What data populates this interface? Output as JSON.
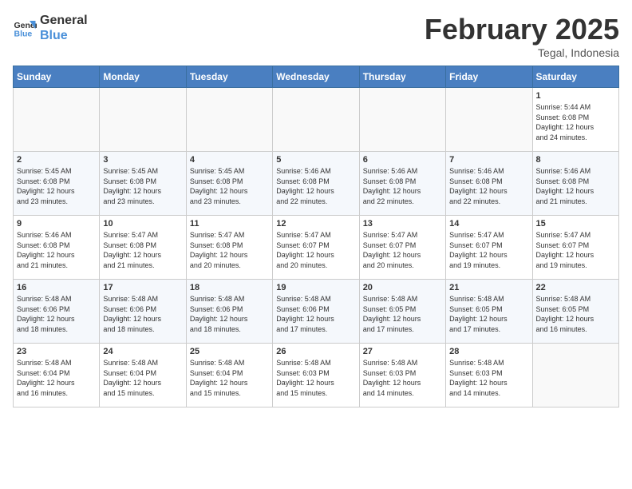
{
  "header": {
    "logo_text1": "General",
    "logo_text2": "Blue",
    "month": "February 2025",
    "location": "Tegal, Indonesia"
  },
  "days_of_week": [
    "Sunday",
    "Monday",
    "Tuesday",
    "Wednesday",
    "Thursday",
    "Friday",
    "Saturday"
  ],
  "weeks": [
    [
      {
        "day": "",
        "info": ""
      },
      {
        "day": "",
        "info": ""
      },
      {
        "day": "",
        "info": ""
      },
      {
        "day": "",
        "info": ""
      },
      {
        "day": "",
        "info": ""
      },
      {
        "day": "",
        "info": ""
      },
      {
        "day": "1",
        "info": "Sunrise: 5:44 AM\nSunset: 6:08 PM\nDaylight: 12 hours\nand 24 minutes."
      }
    ],
    [
      {
        "day": "2",
        "info": "Sunrise: 5:45 AM\nSunset: 6:08 PM\nDaylight: 12 hours\nand 23 minutes."
      },
      {
        "day": "3",
        "info": "Sunrise: 5:45 AM\nSunset: 6:08 PM\nDaylight: 12 hours\nand 23 minutes."
      },
      {
        "day": "4",
        "info": "Sunrise: 5:45 AM\nSunset: 6:08 PM\nDaylight: 12 hours\nand 23 minutes."
      },
      {
        "day": "5",
        "info": "Sunrise: 5:46 AM\nSunset: 6:08 PM\nDaylight: 12 hours\nand 22 minutes."
      },
      {
        "day": "6",
        "info": "Sunrise: 5:46 AM\nSunset: 6:08 PM\nDaylight: 12 hours\nand 22 minutes."
      },
      {
        "day": "7",
        "info": "Sunrise: 5:46 AM\nSunset: 6:08 PM\nDaylight: 12 hours\nand 22 minutes."
      },
      {
        "day": "8",
        "info": "Sunrise: 5:46 AM\nSunset: 6:08 PM\nDaylight: 12 hours\nand 21 minutes."
      }
    ],
    [
      {
        "day": "9",
        "info": "Sunrise: 5:46 AM\nSunset: 6:08 PM\nDaylight: 12 hours\nand 21 minutes."
      },
      {
        "day": "10",
        "info": "Sunrise: 5:47 AM\nSunset: 6:08 PM\nDaylight: 12 hours\nand 21 minutes."
      },
      {
        "day": "11",
        "info": "Sunrise: 5:47 AM\nSunset: 6:08 PM\nDaylight: 12 hours\nand 20 minutes."
      },
      {
        "day": "12",
        "info": "Sunrise: 5:47 AM\nSunset: 6:07 PM\nDaylight: 12 hours\nand 20 minutes."
      },
      {
        "day": "13",
        "info": "Sunrise: 5:47 AM\nSunset: 6:07 PM\nDaylight: 12 hours\nand 20 minutes."
      },
      {
        "day": "14",
        "info": "Sunrise: 5:47 AM\nSunset: 6:07 PM\nDaylight: 12 hours\nand 19 minutes."
      },
      {
        "day": "15",
        "info": "Sunrise: 5:47 AM\nSunset: 6:07 PM\nDaylight: 12 hours\nand 19 minutes."
      }
    ],
    [
      {
        "day": "16",
        "info": "Sunrise: 5:48 AM\nSunset: 6:06 PM\nDaylight: 12 hours\nand 18 minutes."
      },
      {
        "day": "17",
        "info": "Sunrise: 5:48 AM\nSunset: 6:06 PM\nDaylight: 12 hours\nand 18 minutes."
      },
      {
        "day": "18",
        "info": "Sunrise: 5:48 AM\nSunset: 6:06 PM\nDaylight: 12 hours\nand 18 minutes."
      },
      {
        "day": "19",
        "info": "Sunrise: 5:48 AM\nSunset: 6:06 PM\nDaylight: 12 hours\nand 17 minutes."
      },
      {
        "day": "20",
        "info": "Sunrise: 5:48 AM\nSunset: 6:05 PM\nDaylight: 12 hours\nand 17 minutes."
      },
      {
        "day": "21",
        "info": "Sunrise: 5:48 AM\nSunset: 6:05 PM\nDaylight: 12 hours\nand 17 minutes."
      },
      {
        "day": "22",
        "info": "Sunrise: 5:48 AM\nSunset: 6:05 PM\nDaylight: 12 hours\nand 16 minutes."
      }
    ],
    [
      {
        "day": "23",
        "info": "Sunrise: 5:48 AM\nSunset: 6:04 PM\nDaylight: 12 hours\nand 16 minutes."
      },
      {
        "day": "24",
        "info": "Sunrise: 5:48 AM\nSunset: 6:04 PM\nDaylight: 12 hours\nand 15 minutes."
      },
      {
        "day": "25",
        "info": "Sunrise: 5:48 AM\nSunset: 6:04 PM\nDaylight: 12 hours\nand 15 minutes."
      },
      {
        "day": "26",
        "info": "Sunrise: 5:48 AM\nSunset: 6:03 PM\nDaylight: 12 hours\nand 15 minutes."
      },
      {
        "day": "27",
        "info": "Sunrise: 5:48 AM\nSunset: 6:03 PM\nDaylight: 12 hours\nand 14 minutes."
      },
      {
        "day": "28",
        "info": "Sunrise: 5:48 AM\nSunset: 6:03 PM\nDaylight: 12 hours\nand 14 minutes."
      },
      {
        "day": "",
        "info": ""
      }
    ]
  ]
}
